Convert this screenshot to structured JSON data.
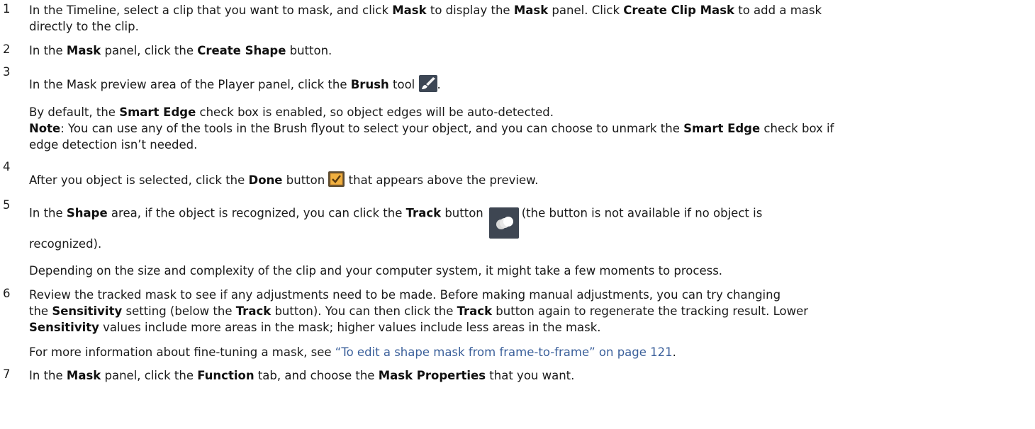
{
  "steps": [
    {
      "num": "1",
      "l1_a": "In the Timeline, select a clip that you want to mask, and click ",
      "l1_b": "Mask",
      "l1_c": " to display the ",
      "l1_d": "Mask",
      "l1_e": " panel. Click ",
      "l1_f": "Create Clip Mask",
      "l1_g": " to add a mask",
      "l2": "directly to the clip."
    },
    {
      "num": "2",
      "a": "In the ",
      "b": "Mask",
      "c": " panel, click the ",
      "d": "Create Shape",
      "e": " button."
    },
    {
      "num": "3",
      "l1_a": "In the Mask preview area of the Player panel, click the ",
      "l1_b": "Brush",
      "l1_c": " tool ",
      "l1_d": ".",
      "l2_a": "By default, the ",
      "l2_b": "Smart Edge",
      "l2_c": " check box is enabled, so object edges will be auto-detected.",
      "l3_a": "Note",
      "l3_b": ": You can use any of the tools in the Brush flyout to select your object, and you can choose to unmark the ",
      "l3_c": "Smart Edge",
      "l3_d": " check box if",
      "l4": "edge detection isn’t needed."
    },
    {
      "num": "4",
      "a": "After you object is selected, click the ",
      "b": "Done",
      "c": " button ",
      "d": " that appears above the preview."
    },
    {
      "num": "5",
      "l1_a": "In the ",
      "l1_b": "Shape",
      "l1_c": " area, if the object is recognized, you can click the ",
      "l1_d": "Track",
      "l1_e": " button",
      "l1_f": "(the button is not available if no object is",
      "l2": "recognized).",
      "l3": "Depending on the size and complexity of the clip and your computer system, it might take a few moments to process."
    },
    {
      "num": "6",
      "l1": "Review the tracked mask to see if any adjustments need to be made. Before making manual adjustments, you can try changing",
      "l2_a": "the ",
      "l2_b": "Sensitivity",
      "l2_c": " setting (below the ",
      "l2_d": "Track",
      "l2_e": " button). You can then click the ",
      "l2_f": "Track",
      "l2_g": " button again to regenerate the tracking result. Lower",
      "l3_a": "Sensitivity",
      "l3_b": " values include more areas in the mask; higher values include less areas in the mask.",
      "l4_a": "For more information about fine-tuning a mask, see ",
      "l4_link": "“To edit a shape mask from frame-to-frame” on page 121",
      "l4_b": "."
    },
    {
      "num": "7",
      "a": "In the ",
      "b": "Mask",
      "c": " panel, click the ",
      "d": "Function",
      "e": " tab, and choose the ",
      "f": "Mask Properties",
      "g": " that you want."
    }
  ]
}
